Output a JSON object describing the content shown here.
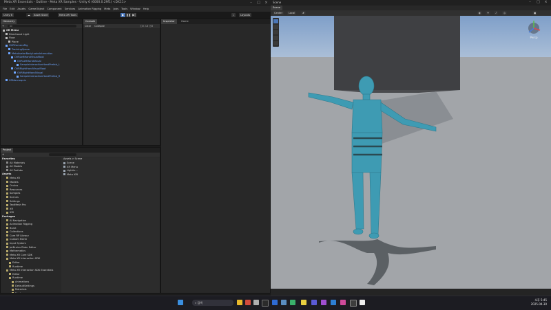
{
  "unity": {
    "title": "Meta XR Essentials - Outline - Meta XR Samples - Unity 6 (6000.0.29f1) <DX11>",
    "menu": [
      "File",
      "Edit",
      "Assets",
      "GameObject",
      "Component",
      "Services",
      "Animation Rigging",
      "Meta",
      "Jobs",
      "Tools",
      "Window",
      "Help"
    ],
    "toolbar": {
      "account_label": "Unity 6",
      "cloud_label": "Asset Store",
      "meta_label": "Meta XR Tools",
      "layout_label": "Layouts"
    },
    "hierarchy": {
      "tab": "Hierarchy",
      "search_placeholder": "All",
      "items": [
        {
          "label": "XR Menu",
          "heading": true
        },
        {
          "label": "Directional Light"
        },
        {
          "label": "Floor"
        },
        {
          "label": "Plane"
        },
        {
          "label": "OVRCameraRig",
          "blue": true
        },
        {
          "label": "TrackingSpace",
          "blue": true
        },
        {
          "label": "MetaAvatarBodyLooksInteraction",
          "blue": true
        },
        {
          "label": "OVRLeftHandVisualRoot",
          "blue": true
        },
        {
          "label": "OVRLeftHandVisual",
          "blue": true
        },
        {
          "label": "SampleInteractionHandPrefab_L",
          "blue": true
        },
        {
          "label": "OVRRightHandVisualRoot",
          "blue": true
        },
        {
          "label": "OVRRightHandVisual",
          "blue": true
        },
        {
          "label": "SampleInteractionHandPrefab_R",
          "blue": true
        },
        {
          "label": "XRMannequin",
          "blue": true
        }
      ]
    },
    "console": {
      "tab": "Console",
      "buttons": [
        "Clear",
        "Collapse"
      ]
    },
    "inspector": {
      "tab": "Inspector"
    },
    "game": {
      "tab": "Game"
    },
    "project": {
      "tab": "Project",
      "favorites_title": "Favorites",
      "favorites": [
        "All Materials",
        "All Models",
        "All Prefabs"
      ],
      "assets_title": "Assets",
      "assets": [
        "Meta XR",
        "Models",
        "Oculus",
        "Resources",
        "Samples",
        "Scenes",
        "Settings",
        "TextMesh Pro",
        "XR",
        "XRI"
      ],
      "packages_title": "Packages",
      "packages": [
        "AI Navigation",
        "Animation Rigging",
        "Burst",
        "Collections",
        "Core RP Library",
        "Custom NUnit",
        "Input System",
        "JetBrains Rider Editor",
        "Mathematics",
        "Meta XR Core SDK",
        "Meta XR Interaction SDK",
        "Editor",
        "Runtime",
        "Meta XR Interaction SDK Essentials",
        "Editor",
        "Runtime",
        "Animations",
        "DefaultSettings",
        "Materials",
        "Meshes",
        "Objects",
        "Prefabs"
      ],
      "breadcrumb": "Assets > Scene",
      "files": [
        "Scene",
        "XR Menu",
        "Lightin...",
        "Meta XRI"
      ]
    }
  },
  "scene": {
    "title": "Scene",
    "tabs": [
      "Scene"
    ],
    "toolbar": [
      "Center",
      "Local"
    ],
    "view_mode": "Persp"
  },
  "taskbar": {
    "search_placeholder": "검색",
    "time": "오후 5:45",
    "date": "2025-04-30"
  },
  "colors": {
    "unity_bg": "#1b1b1b",
    "panel_bg": "#282828",
    "accent_blue": "#4a76b8",
    "prefab_blue": "#6fa6ff",
    "mannequin": "#3e9bb3",
    "sky": "#9fb9d8",
    "floor": "#a2a5a9"
  }
}
